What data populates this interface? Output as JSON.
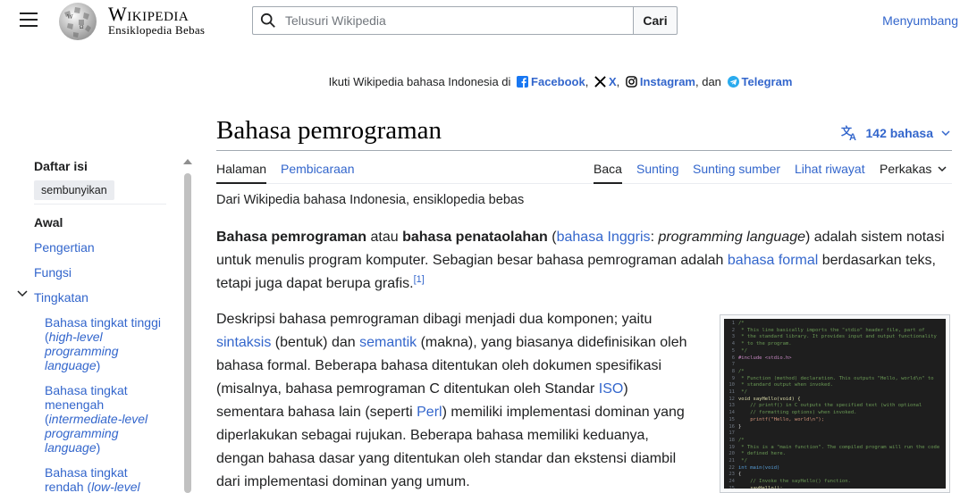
{
  "header": {
    "wordmark": "Wikipedia",
    "tagline": "Ensiklopedia Bebas",
    "search_placeholder": "Telusuri Wikipedia",
    "search_button": "Cari",
    "donate": "Menyumbang"
  },
  "banner": {
    "prefix": "Ikuti Wikipedia bahasa Indonesia di",
    "facebook": "Facebook",
    "x": "X",
    "instagram": "Instagram",
    "and": ", dan",
    "telegram": "Telegram"
  },
  "toc": {
    "title": "Daftar isi",
    "hide": "sembunyikan",
    "items": [
      "Awal",
      "Pengertian",
      "Fungsi",
      "Tingkatan"
    ],
    "sub_items": [
      {
        "label": "Bahasa tingkat tinggi (",
        "italic": "high-level programming language",
        "end": ")"
      },
      {
        "label": "Bahasa tingkat menengah (",
        "italic": "intermediate-level programming language",
        "end": ")"
      },
      {
        "label": "Bahasa tingkat rendah (",
        "italic": "low-level",
        "end": ""
      }
    ]
  },
  "article": {
    "title": "Bahasa pemrograman",
    "languages": "142 bahasa",
    "tabs_left": [
      "Halaman",
      "Pembicaraan"
    ],
    "tabs_right": [
      "Baca",
      "Sunting",
      "Sunting sumber",
      "Lihat riwayat",
      "Perkakas"
    ],
    "from": "Dari Wikipedia bahasa Indonesia, ensiklopedia bebas",
    "p1": {
      "b1": "Bahasa pemrograman",
      "t1": " atau ",
      "b2": "bahasa penataolahan",
      "t2": " (",
      "link1": "bahasa Inggris",
      "t3": ": ",
      "i1": "programming language",
      "t4": ") adalah sistem notasi untuk menulis program komputer. Sebagian besar bahasa pemrograman adalah ",
      "link2": "bahasa formal",
      "t5": " berdasarkan teks, tetapi juga dapat berupa grafis.",
      "ref": "[1]"
    },
    "p2": {
      "t1": "Deskripsi bahasa pemrograman dibagi menjadi dua komponen; yaitu ",
      "link1": "sintaksis",
      "t2": " (bentuk) dan ",
      "link2": "semantik",
      "t3": " (makna), yang biasanya didefinisikan oleh bahasa formal. Beberapa bahasa ditentukan oleh dokumen spesifikasi (misalnya, bahasa pemrograman C ditentukan oleh Standar ",
      "link3": "ISO",
      "t4": ") sementara bahasa lain (seperti ",
      "link4": "Perl",
      "t5": ") memiliki implementasi dominan yang diperlakukan sebagai rujukan. Beberapa bahasa memiliki keduanya, dengan bahasa dasar yang ditentukan oleh standar dan ekstensi diambil dari implementasi dominan yang umum."
    }
  },
  "code_image": {
    "lines": [
      {
        "n": "1",
        "cls": "c-com",
        "t": "/*"
      },
      {
        "n": "2",
        "cls": "c-com",
        "t": " * This line basically imports the \"stdio\" header file, part of"
      },
      {
        "n": "3",
        "cls": "c-com",
        "t": " * the standard library. It provides input and output functionality"
      },
      {
        "n": "4",
        "cls": "c-com",
        "t": " * to the program."
      },
      {
        "n": "5",
        "cls": "c-com",
        "t": " */"
      },
      {
        "n": "6",
        "cls": "c-pp",
        "t": "#include <stdio.h>"
      },
      {
        "n": "7",
        "cls": "c-tx",
        "t": ""
      },
      {
        "n": "8",
        "cls": "c-com",
        "t": "/*"
      },
      {
        "n": "9",
        "cls": "c-com",
        "t": " * Function (method) declaration. This outputs \"Hello, world\\n\" to"
      },
      {
        "n": "10",
        "cls": "c-com",
        "t": " * standard output when invoked."
      },
      {
        "n": "11",
        "cls": "c-com",
        "t": " */"
      },
      {
        "n": "12",
        "cls": "c-fn",
        "t": "void sayHello(void) {"
      },
      {
        "n": "13",
        "cls": "c-com",
        "t": "    // printf() in C outputs the specified text (with optional"
      },
      {
        "n": "14",
        "cls": "c-com",
        "t": "    // formatting options) when invoked."
      },
      {
        "n": "15",
        "cls": "c-str",
        "t": "    printf(\"Hello, world\\n\");"
      },
      {
        "n": "16",
        "cls": "c-tx",
        "t": "}"
      },
      {
        "n": "17",
        "cls": "c-tx",
        "t": ""
      },
      {
        "n": "18",
        "cls": "c-com",
        "t": "/*"
      },
      {
        "n": "19",
        "cls": "c-com",
        "t": " * This is a \"main function\". The compiled program will run the code"
      },
      {
        "n": "20",
        "cls": "c-com",
        "t": " * defined here."
      },
      {
        "n": "21",
        "cls": "c-com",
        "t": " */"
      },
      {
        "n": "22",
        "cls": "c-kw",
        "t": "int main(void)"
      },
      {
        "n": "23",
        "cls": "c-tx",
        "t": "{"
      },
      {
        "n": "24",
        "cls": "c-com",
        "t": "    // Invoke the sayHello() function."
      },
      {
        "n": "25",
        "cls": "c-fn",
        "t": "    sayHello();"
      }
    ]
  }
}
